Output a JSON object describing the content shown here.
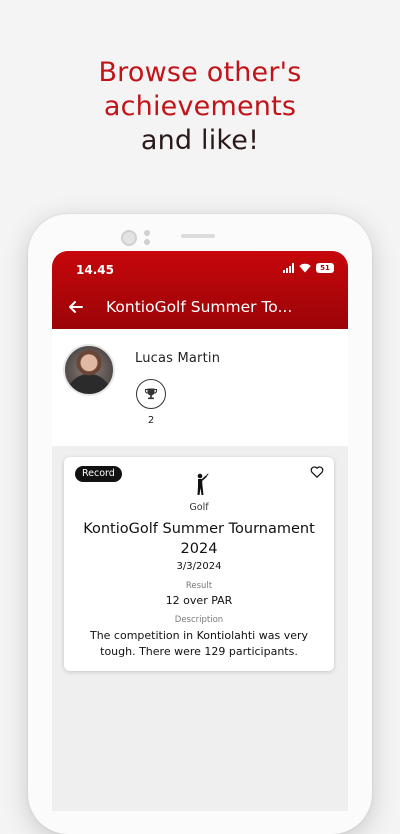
{
  "promo": {
    "line1": "Browse other's",
    "line2": "achievements",
    "line3": "and like!"
  },
  "status_bar": {
    "time": "14.45",
    "battery": "51"
  },
  "app_bar": {
    "title": "KontioGolf Summer To..."
  },
  "profile": {
    "name": "Lucas Martin",
    "trophy_count": "2"
  },
  "achievement": {
    "badge": "Record",
    "sport": "Golf",
    "title": "KontioGolf Summer Tournament 2024",
    "date": "3/3/2024",
    "result_label": "Result",
    "result_value": "12 over PAR",
    "description_label": "Description",
    "description": "The competition in Kontiolahti was very tough. There were 129 participants."
  },
  "icons": {
    "back": "arrow-left-icon",
    "trophy": "trophy-icon",
    "like": "heart-outline-icon",
    "sport": "golfer-icon"
  },
  "colors": {
    "brand": "#c0141a",
    "appbar_top": "#c7070b",
    "appbar_bottom": "#9a0408"
  }
}
